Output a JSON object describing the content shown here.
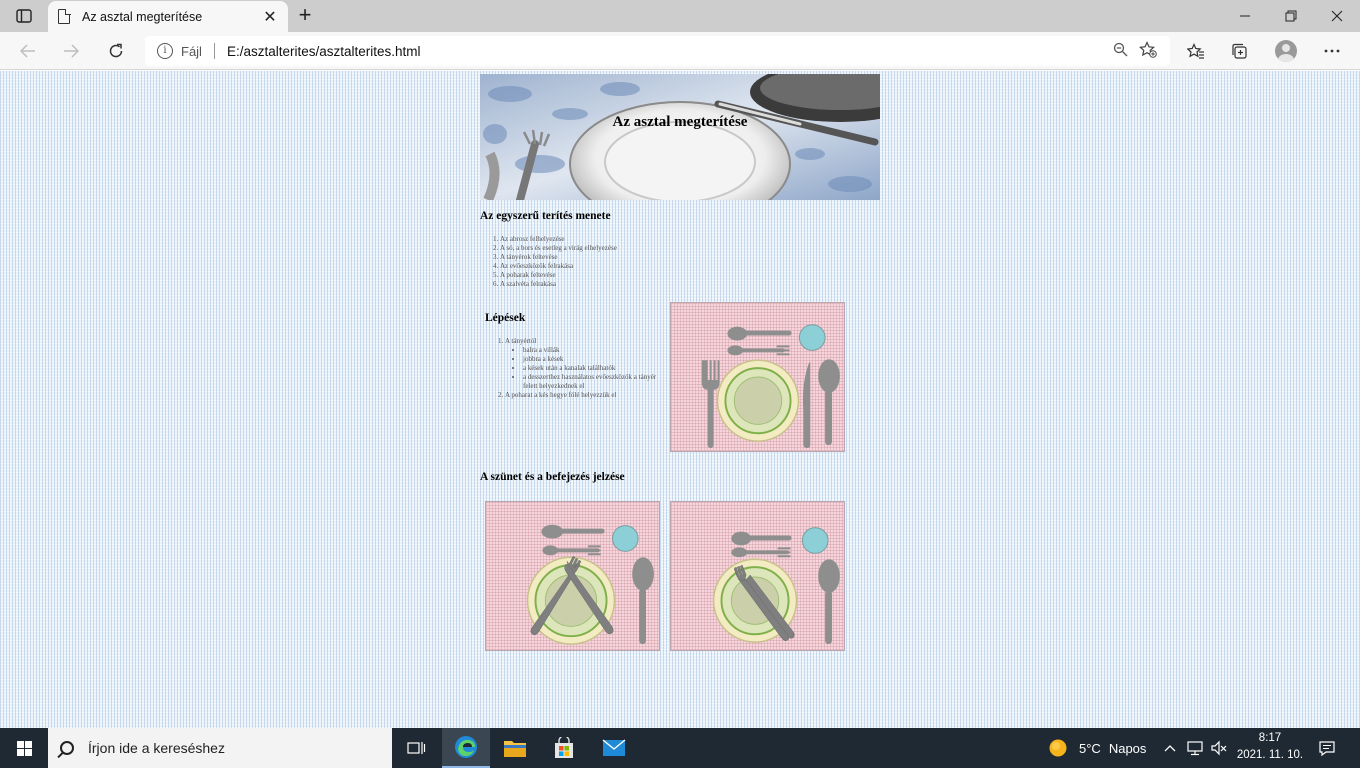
{
  "browser": {
    "tab": {
      "title": "Az asztal megterítése",
      "close_glyph": "✕"
    },
    "new_tab_glyph": "+",
    "window_controls": {
      "minimize": "—",
      "restore": "❐",
      "close": "✕"
    },
    "address": {
      "scheme_label": "Fájl",
      "url": "E:/asztalterites/asztalterites.html"
    }
  },
  "page": {
    "banner_title": "Az asztal megterítése",
    "section1": {
      "heading": "Az egyszerű terítés menete",
      "steps": [
        "Az abrosz felhelyezése",
        "A só, a bors és esetleg a virág elhelyezése",
        "A tányérok feltevése",
        "Az evőeszközök felrakása",
        "A poharak feltevése",
        "A szalvéta felrakása"
      ]
    },
    "section2": {
      "heading": "Lépések",
      "item1": "A tányértól",
      "subitems": [
        "balra a villák",
        "jobbra a kések",
        "a kések után a kanalak találhatók",
        "a desszerthez használatos evőeszközök a tányér felett helyezkednek el"
      ],
      "item2": "A poharat a kés hegye fölé helyezzük el"
    },
    "section3": {
      "heading": "A szünet és a befejezés jelzése"
    }
  },
  "taskbar": {
    "search_placeholder": "Írjon ide a kereséshez",
    "weather": {
      "temp": "5°C",
      "condition": "Napos"
    },
    "time": "8:17",
    "date": "2021. 11. 10."
  },
  "colors": {
    "accent": "#0078d4",
    "taskbar": "#1f2933",
    "placemat": "#f6d5dc",
    "glass": "#8ccfd6",
    "plate_rim": "#7fb04a"
  }
}
